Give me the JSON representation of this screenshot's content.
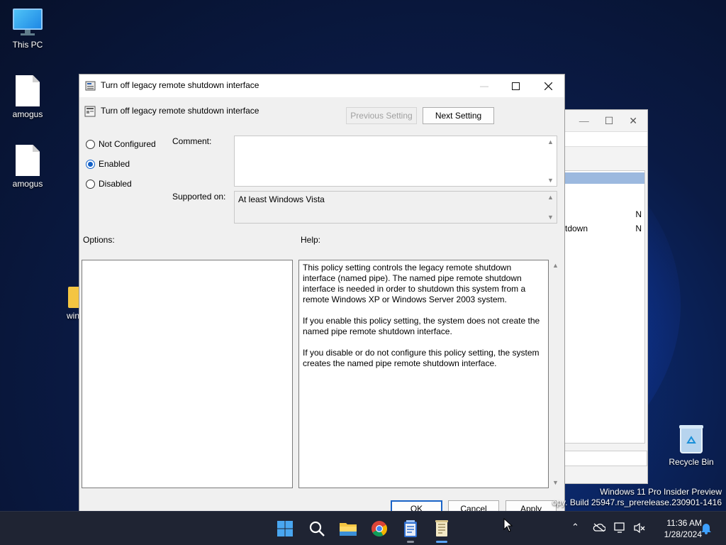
{
  "desktop": {
    "icons": [
      {
        "label": "This PC"
      },
      {
        "label": "amogus"
      },
      {
        "label": "amogus"
      },
      {
        "label": "win"
      },
      {
        "label": "Recycle Bin"
      }
    ],
    "watermark_line1": "Windows 11 Pro Insider Preview",
    "watermark_line2": "opy. Build 25947.rs_prerelease.230901-1416"
  },
  "background_window": {
    "row1_right": "N",
    "row2_left": "tdown",
    "row2_right": "N"
  },
  "dialog": {
    "window_title": "Turn off legacy remote shutdown interface",
    "policy_title": "Turn off legacy remote shutdown interface",
    "prev_button": "Previous Setting",
    "next_button": "Next Setting",
    "radios": {
      "not_configured": "Not Configured",
      "enabled": "Enabled",
      "disabled": "Disabled",
      "selected": "Enabled"
    },
    "comment_label": "Comment:",
    "comment_value": "",
    "supported_label": "Supported on:",
    "supported_value": "At least Windows Vista",
    "options_label": "Options:",
    "help_label": "Help:",
    "help_paragraphs": [
      "This policy setting controls the legacy remote shutdown interface (named pipe). The named pipe remote shutdown interface is needed in order to shutdown this system from a remote Windows XP or Windows Server 2003 system.",
      "If you enable this policy setting, the system does not create the named pipe remote shutdown interface.",
      "If you disable or do not configure this policy setting, the system creates the named pipe remote shutdown interface."
    ],
    "ok_button": "OK",
    "cancel_button": "Cancel",
    "apply_button": "Apply"
  },
  "taskbar": {
    "time": "11:36 AM",
    "date": "1/28/2024",
    "icons": [
      "windows-start-icon",
      "search-icon",
      "file-explorer-icon",
      "chrome-icon",
      "notepad-icon",
      "policy-editor-icon"
    ]
  },
  "colors": {
    "accent": "#1160c8",
    "taskbar": "#1f2433"
  }
}
